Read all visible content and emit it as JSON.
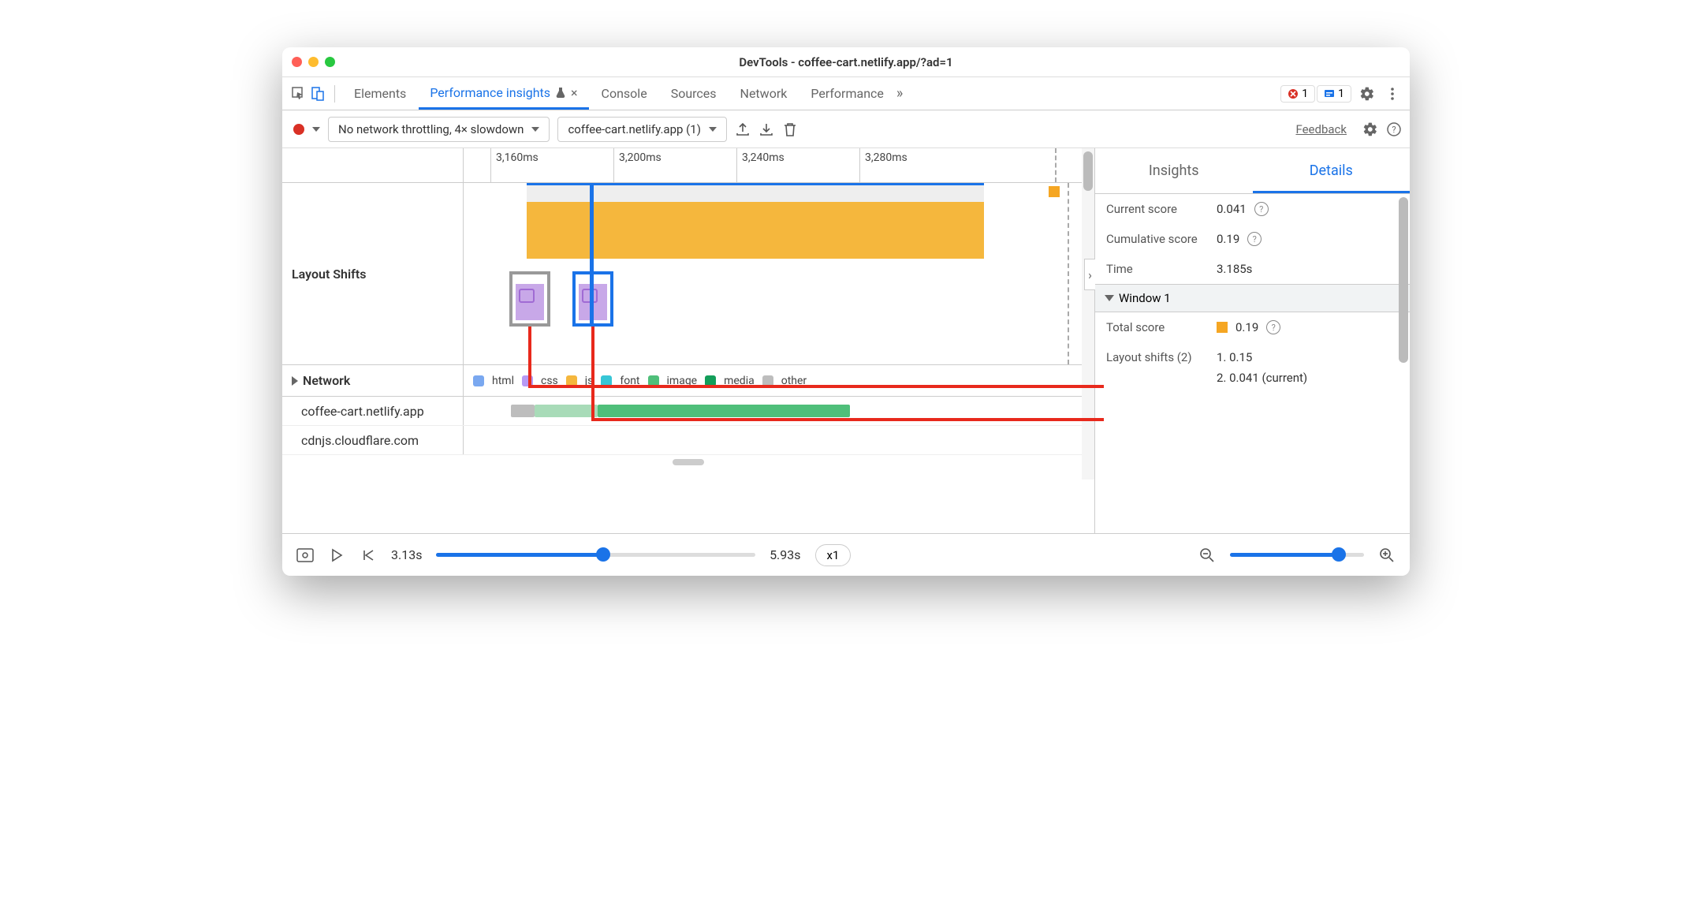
{
  "window": {
    "title": "DevTools - coffee-cart.netlify.app/?ad=1"
  },
  "tabs": {
    "elements": "Elements",
    "perf_insights": "Performance insights",
    "console": "Console",
    "sources": "Sources",
    "network": "Network",
    "performance": "Performance"
  },
  "badges": {
    "errors": "1",
    "issues": "1"
  },
  "toolbar": {
    "throttling": "No network throttling, 4× slowdown",
    "target": "coffee-cart.netlify.app (1)",
    "feedback": "Feedback"
  },
  "ruler": {
    "ticks": [
      "3,160ms",
      "3,200ms",
      "3,240ms",
      "3,280ms"
    ]
  },
  "tracks": {
    "layout_shifts": "Layout Shifts",
    "network": "Network"
  },
  "legend": {
    "html": "html",
    "css": "css",
    "js": "js",
    "font": "font",
    "image": "image",
    "media": "media",
    "other": "other"
  },
  "legend_colors": {
    "html": "#7aa8f0",
    "css": "#b79af5",
    "js": "#f5b73d",
    "font": "#37c6d6",
    "image": "#4fbf7a",
    "media": "#139e5a",
    "other": "#bdbdbd"
  },
  "network_rows": {
    "r1": "coffee-cart.netlify.app",
    "r2": "cdnjs.cloudflare.com"
  },
  "side": {
    "tab_insights": "Insights",
    "tab_details": "Details",
    "current_score_label": "Current score",
    "current_score": "0.041",
    "cumulative_label": "Cumulative score",
    "cumulative": "0.19",
    "time_label": "Time",
    "time": "3.185s",
    "window_head": "Window 1",
    "total_score_label": "Total score",
    "total_score": "0.19",
    "layout_shifts_label": "Layout shifts (2)",
    "shift1": "1. 0.15",
    "shift2": "2. 0.041 (current)"
  },
  "playbar": {
    "start": "3.13s",
    "end": "5.93s",
    "speed": "x1"
  }
}
